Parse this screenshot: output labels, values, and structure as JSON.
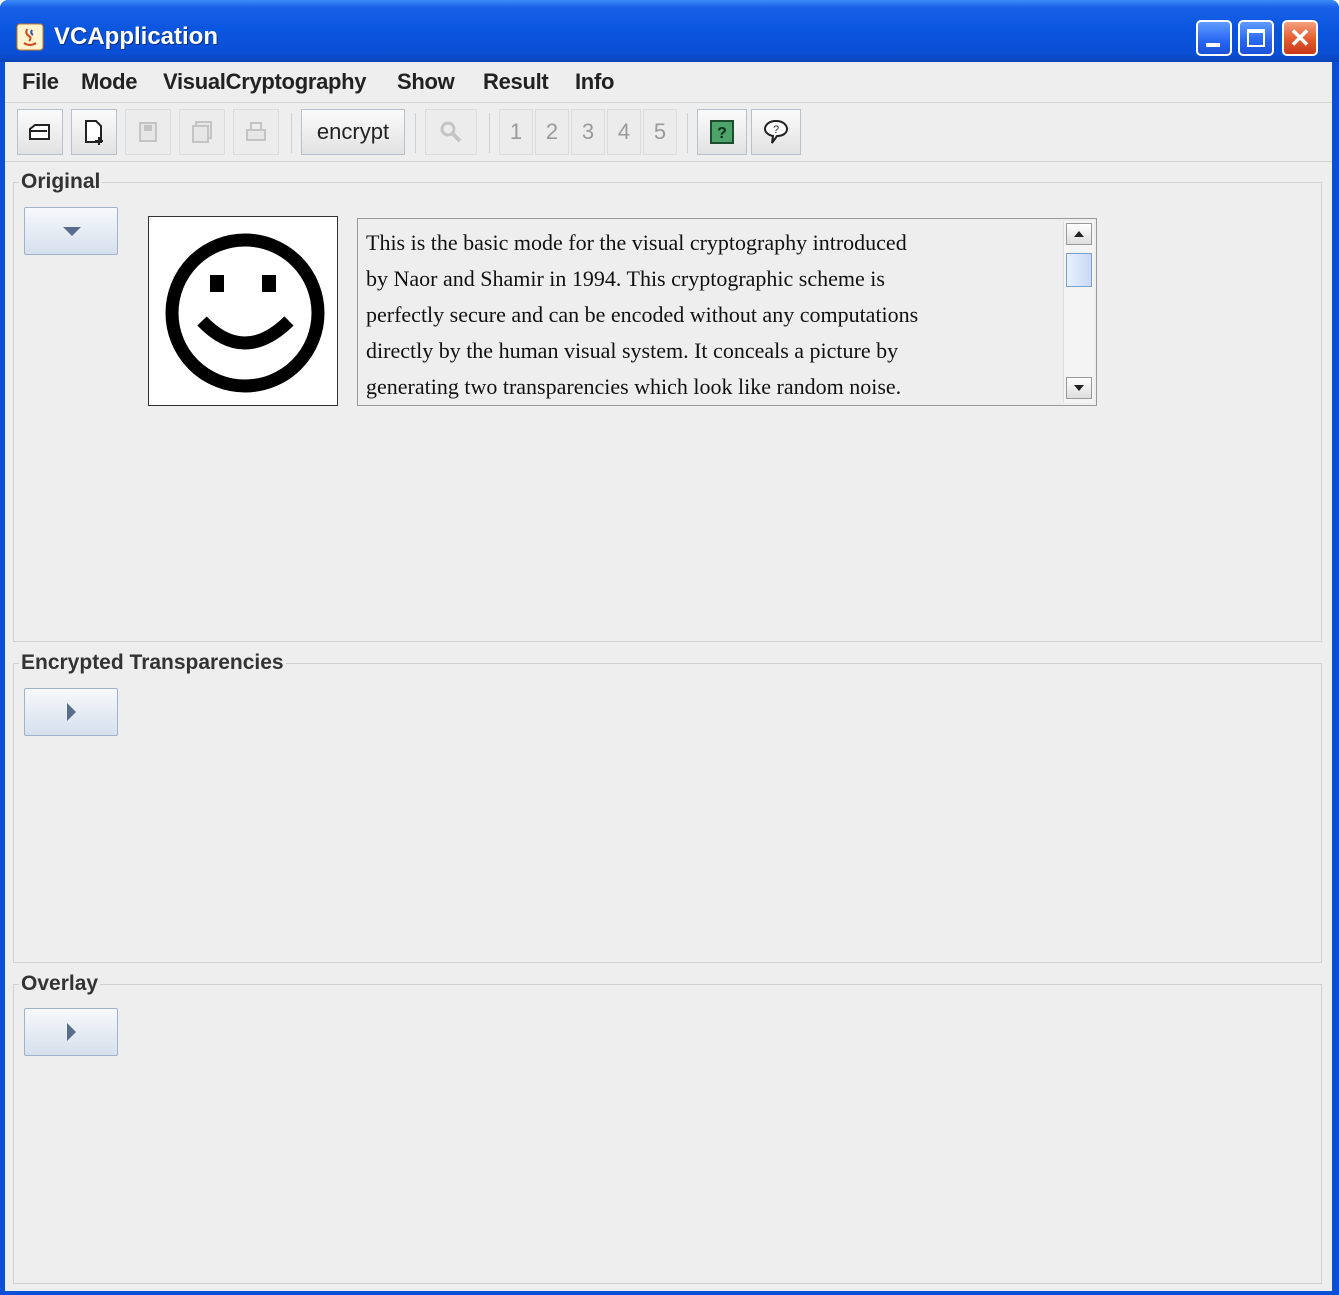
{
  "window": {
    "title": "VCApplication",
    "title_color": "#0a4fd6"
  },
  "menubar": {
    "items": [
      "File",
      "Mode",
      "VisualCryptography",
      "Show",
      "Result",
      "Info"
    ]
  },
  "toolbar": {
    "open_icon": "folder-open-icon",
    "new_icon": "new-file-icon",
    "save_icon": "save-icon",
    "save_as_icon": "save-as-icon",
    "print_icon": "print-icon",
    "encrypt_label": "encrypt",
    "zoom_icon": "magnifier-icon",
    "share_buttons": [
      "1",
      "2",
      "3",
      "4",
      "5"
    ],
    "help_icon": "help-icon",
    "info_icon": "speech-bubble-icon"
  },
  "panels": {
    "original": {
      "title": "Original",
      "toggle_icon": "chevron-down-icon",
      "image_icon": "smiley-face-icon",
      "description": "This is the basic mode for the visual cryptography introduced\nby Naor and Shamir in 1994.  This cryptographic scheme is\nperfectly secure and can be encoded without any computations\ndirectly by the human visual system.  It conceals a picture by\ngenerating two transparencies which look like random noise."
    },
    "encrypted": {
      "title": "Encrypted Transparencies",
      "toggle_icon": "chevron-right-icon"
    },
    "overlay": {
      "title": "Overlay",
      "toggle_icon": "chevron-right-icon"
    }
  }
}
